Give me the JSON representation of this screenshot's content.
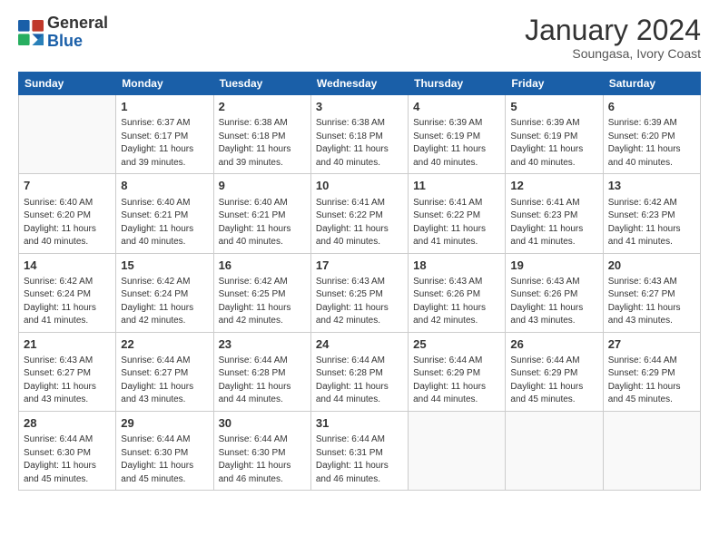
{
  "header": {
    "logo_text_general": "General",
    "logo_text_blue": "Blue",
    "month": "January 2024",
    "location": "Soungasa, Ivory Coast"
  },
  "days_of_week": [
    "Sunday",
    "Monday",
    "Tuesday",
    "Wednesday",
    "Thursday",
    "Friday",
    "Saturday"
  ],
  "weeks": [
    [
      {
        "day": "",
        "empty": true
      },
      {
        "day": "1",
        "sunrise": "6:37 AM",
        "sunset": "6:17 PM",
        "daylight": "11 hours and 39 minutes."
      },
      {
        "day": "2",
        "sunrise": "6:38 AM",
        "sunset": "6:18 PM",
        "daylight": "11 hours and 39 minutes."
      },
      {
        "day": "3",
        "sunrise": "6:38 AM",
        "sunset": "6:18 PM",
        "daylight": "11 hours and 40 minutes."
      },
      {
        "day": "4",
        "sunrise": "6:39 AM",
        "sunset": "6:19 PM",
        "daylight": "11 hours and 40 minutes."
      },
      {
        "day": "5",
        "sunrise": "6:39 AM",
        "sunset": "6:19 PM",
        "daylight": "11 hours and 40 minutes."
      },
      {
        "day": "6",
        "sunrise": "6:39 AM",
        "sunset": "6:20 PM",
        "daylight": "11 hours and 40 minutes."
      }
    ],
    [
      {
        "day": "7",
        "sunrise": "6:40 AM",
        "sunset": "6:20 PM",
        "daylight": "11 hours and 40 minutes."
      },
      {
        "day": "8",
        "sunrise": "6:40 AM",
        "sunset": "6:21 PM",
        "daylight": "11 hours and 40 minutes."
      },
      {
        "day": "9",
        "sunrise": "6:40 AM",
        "sunset": "6:21 PM",
        "daylight": "11 hours and 40 minutes."
      },
      {
        "day": "10",
        "sunrise": "6:41 AM",
        "sunset": "6:22 PM",
        "daylight": "11 hours and 40 minutes."
      },
      {
        "day": "11",
        "sunrise": "6:41 AM",
        "sunset": "6:22 PM",
        "daylight": "11 hours and 41 minutes."
      },
      {
        "day": "12",
        "sunrise": "6:41 AM",
        "sunset": "6:23 PM",
        "daylight": "11 hours and 41 minutes."
      },
      {
        "day": "13",
        "sunrise": "6:42 AM",
        "sunset": "6:23 PM",
        "daylight": "11 hours and 41 minutes."
      }
    ],
    [
      {
        "day": "14",
        "sunrise": "6:42 AM",
        "sunset": "6:24 PM",
        "daylight": "11 hours and 41 minutes."
      },
      {
        "day": "15",
        "sunrise": "6:42 AM",
        "sunset": "6:24 PM",
        "daylight": "11 hours and 42 minutes."
      },
      {
        "day": "16",
        "sunrise": "6:42 AM",
        "sunset": "6:25 PM",
        "daylight": "11 hours and 42 minutes."
      },
      {
        "day": "17",
        "sunrise": "6:43 AM",
        "sunset": "6:25 PM",
        "daylight": "11 hours and 42 minutes."
      },
      {
        "day": "18",
        "sunrise": "6:43 AM",
        "sunset": "6:26 PM",
        "daylight": "11 hours and 42 minutes."
      },
      {
        "day": "19",
        "sunrise": "6:43 AM",
        "sunset": "6:26 PM",
        "daylight": "11 hours and 43 minutes."
      },
      {
        "day": "20",
        "sunrise": "6:43 AM",
        "sunset": "6:27 PM",
        "daylight": "11 hours and 43 minutes."
      }
    ],
    [
      {
        "day": "21",
        "sunrise": "6:43 AM",
        "sunset": "6:27 PM",
        "daylight": "11 hours and 43 minutes."
      },
      {
        "day": "22",
        "sunrise": "6:44 AM",
        "sunset": "6:27 PM",
        "daylight": "11 hours and 43 minutes."
      },
      {
        "day": "23",
        "sunrise": "6:44 AM",
        "sunset": "6:28 PM",
        "daylight": "11 hours and 44 minutes."
      },
      {
        "day": "24",
        "sunrise": "6:44 AM",
        "sunset": "6:28 PM",
        "daylight": "11 hours and 44 minutes."
      },
      {
        "day": "25",
        "sunrise": "6:44 AM",
        "sunset": "6:29 PM",
        "daylight": "11 hours and 44 minutes."
      },
      {
        "day": "26",
        "sunrise": "6:44 AM",
        "sunset": "6:29 PM",
        "daylight": "11 hours and 45 minutes."
      },
      {
        "day": "27",
        "sunrise": "6:44 AM",
        "sunset": "6:29 PM",
        "daylight": "11 hours and 45 minutes."
      }
    ],
    [
      {
        "day": "28",
        "sunrise": "6:44 AM",
        "sunset": "6:30 PM",
        "daylight": "11 hours and 45 minutes."
      },
      {
        "day": "29",
        "sunrise": "6:44 AM",
        "sunset": "6:30 PM",
        "daylight": "11 hours and 45 minutes."
      },
      {
        "day": "30",
        "sunrise": "6:44 AM",
        "sunset": "6:30 PM",
        "daylight": "11 hours and 46 minutes."
      },
      {
        "day": "31",
        "sunrise": "6:44 AM",
        "sunset": "6:31 PM",
        "daylight": "11 hours and 46 minutes."
      },
      {
        "day": "",
        "empty": true
      },
      {
        "day": "",
        "empty": true
      },
      {
        "day": "",
        "empty": true
      }
    ]
  ]
}
